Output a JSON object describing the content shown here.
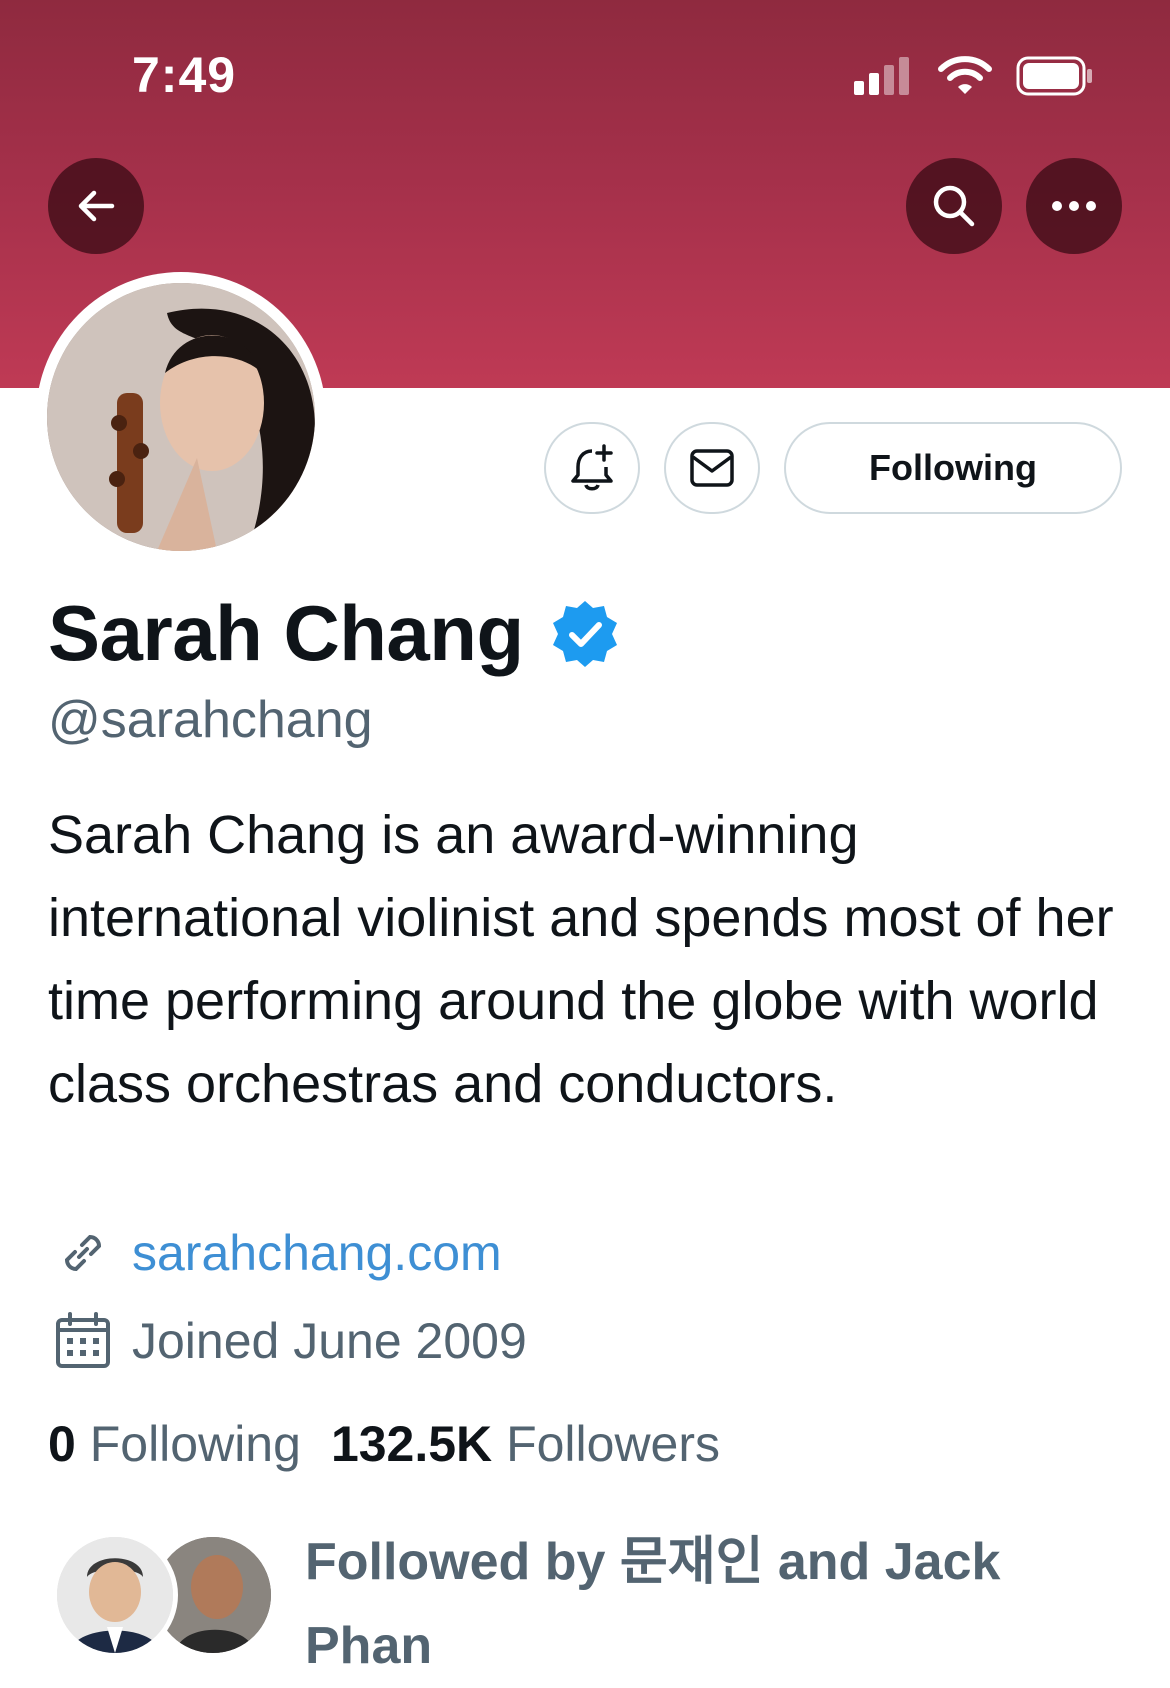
{
  "status_bar": {
    "time": "7:49"
  },
  "header": {
    "back_icon": "arrow-left-icon",
    "search_icon": "search-icon",
    "more_icon": "more-dots-icon",
    "banner_color": "#b23651"
  },
  "profile": {
    "name": "Sarah Chang",
    "verified": true,
    "handle": "@sarahchang",
    "bio": "Sarah Chang is an award-winning international violinist and spends most of her time performing around the globe with world class orchestras and conductors.",
    "link": "sarahchang.com",
    "joined": "Joined June 2009",
    "following_count": "0",
    "following_label": "Following",
    "followers_count": "132.5K",
    "followers_label": "Followers",
    "followed_by": "Followed by 문재인 and Jack Phan"
  },
  "actions": {
    "notify_icon": "bell-plus-icon",
    "message_icon": "mail-icon",
    "follow_label": "Following"
  },
  "colors": {
    "link": "#3e8fd4",
    "secondary_text": "#536471",
    "verified": "#1d9bf0"
  }
}
